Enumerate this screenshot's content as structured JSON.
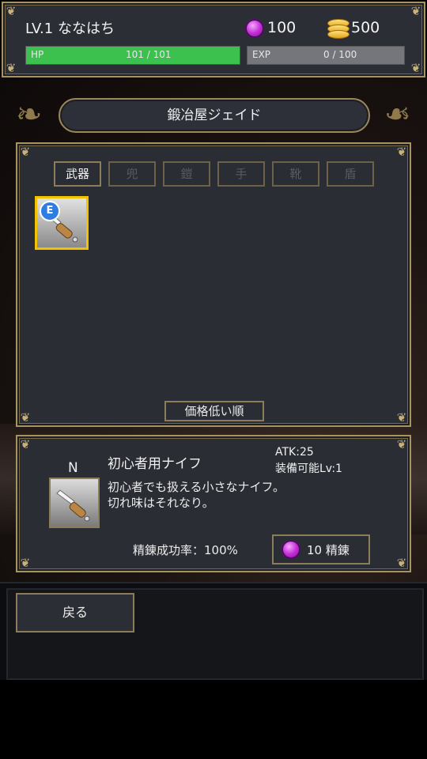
{
  "player": {
    "level_name": "LV.1 ななはち",
    "gems": "100",
    "coins": "500",
    "hp_label": "HP",
    "hp_value": "101 / 101",
    "hp_fraction": 1.0,
    "exp_label": "EXP",
    "exp_value": "0 / 100",
    "exp_fraction": 0.0
  },
  "shop": {
    "title": "鍛冶屋ジェイド"
  },
  "tabs": [
    {
      "label": "武器",
      "active": true
    },
    {
      "label": "兜",
      "active": false
    },
    {
      "label": "鎧",
      "active": false
    },
    {
      "label": "手",
      "active": false
    },
    {
      "label": "靴",
      "active": false
    },
    {
      "label": "盾",
      "active": false
    }
  ],
  "inventory": {
    "slots": [
      {
        "item": "knife",
        "equipped": true,
        "equipped_badge": "E",
        "selected": true
      }
    ],
    "sort_label": "価格低い順"
  },
  "detail": {
    "rarity": "N",
    "name": "初心者用ナイフ",
    "atk": "ATK:25",
    "equip_level": "装備可能Lv:1",
    "description_line1": "初心者でも扱える小さなナイフ。",
    "description_line2": "切れ味はそれなり。",
    "refine_rate": "精錬成功率：100%",
    "refine_button": "10 精錬"
  },
  "footer": {
    "back_label": "戻る"
  },
  "icons": {
    "gem": "gem-icon",
    "coin": "coin-stack-icon",
    "knife": "knife-icon"
  },
  "colors": {
    "hp_fill": "#3cc14f",
    "gold_frame": "#a8925e",
    "panel_bg": "#2a2d34",
    "selected_slot": "#f2c200"
  }
}
